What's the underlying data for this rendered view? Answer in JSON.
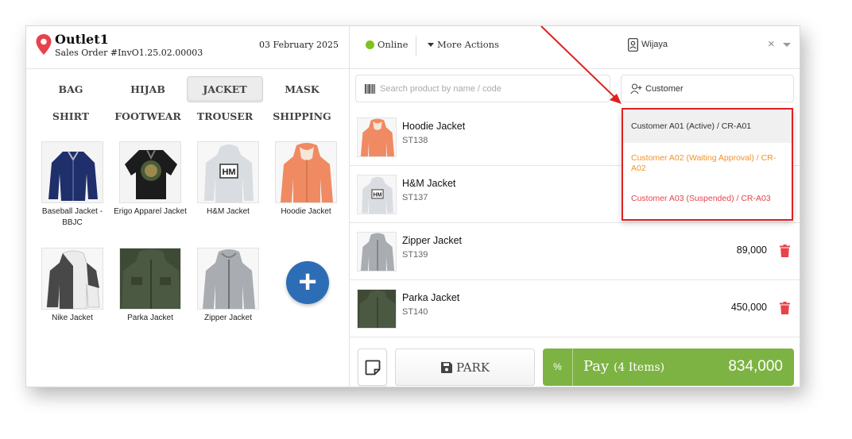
{
  "header": {
    "outlet_name": "Outlet1",
    "order_number": "Sales Order #InvO1.25.02.00003",
    "date": "03 February 2025"
  },
  "categories": [
    {
      "label": "BAG"
    },
    {
      "label": "HIJAB"
    },
    {
      "label": "JACKET",
      "active": true
    },
    {
      "label": "MASK"
    },
    {
      "label": "SHIRT"
    },
    {
      "label": "FOOTWEAR"
    },
    {
      "label": "TROUSER"
    },
    {
      "label": "SHIPPING"
    }
  ],
  "products": [
    {
      "name": "Baseball Jacket - BBJC"
    },
    {
      "name": "Erigo Apparel Jacket"
    },
    {
      "name": "H&M Jacket"
    },
    {
      "name": "Hoodie Jacket"
    },
    {
      "name": "Nike Jacket"
    },
    {
      "name": "Parka Jacket"
    },
    {
      "name": "Zipper Jacket"
    }
  ],
  "topbar": {
    "online_label": "Online",
    "more_actions_label": "More Actions",
    "user_name": "Wijaya",
    "clear_symbol": "×"
  },
  "search": {
    "placeholder": "Search product by name / code"
  },
  "customer": {
    "label": "Customer",
    "options": [
      {
        "label": "Customer A01 (Active) / CR-A01",
        "color": "#333333"
      },
      {
        "label": "Customer A02 (Waiting Approval) / CR-A02",
        "color": "#f0932b"
      },
      {
        "label": "Customer A03 (Suspended) / CR-A03",
        "color": "#e8424a"
      }
    ]
  },
  "cart": [
    {
      "name": "Hoodie Jacket",
      "code": "ST138",
      "price": ""
    },
    {
      "name": "H&M Jacket",
      "code": "ST137",
      "price": ""
    },
    {
      "name": "Zipper Jacket",
      "code": "ST139",
      "price": "89,000"
    },
    {
      "name": "Parka Jacket",
      "code": "ST140",
      "price": "450,000"
    }
  ],
  "footer": {
    "park_label": "PARK",
    "pay_percent": "%",
    "pay_label": "Pay",
    "pay_items": "(4 Items)",
    "pay_total": "834,000"
  },
  "colors": {
    "accent_green": "#7cb342",
    "online_green": "#7dc21e",
    "add_button_blue": "#2d6db5",
    "trash_red": "#e8424a",
    "highlight_red": "#e02020"
  }
}
